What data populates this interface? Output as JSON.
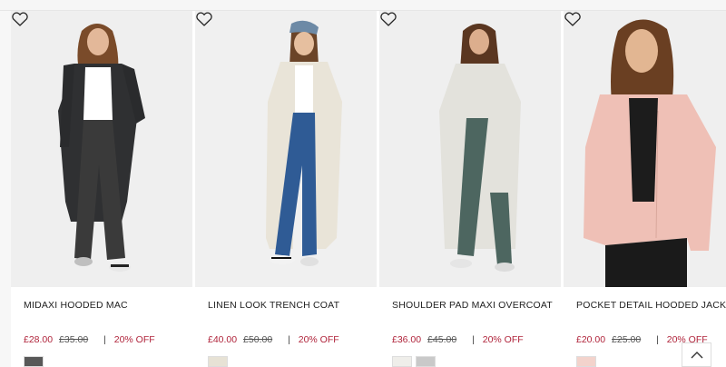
{
  "products": [
    {
      "name": "MIDAXI HOODED MAC",
      "price": "£28.00",
      "was": "£35.00",
      "sep": "|",
      "discount": "20% OFF",
      "swatches": [
        "#585858"
      ],
      "bg": "#efefef",
      "coat": "#2f3032"
    },
    {
      "name": "LINEN LOOK TRENCH COAT",
      "price": "£40.00",
      "was": "£50.00",
      "sep": "|",
      "discount": "20% OFF",
      "swatches": [
        "#e7e2d5"
      ],
      "bg": "#f0f0f0",
      "coat": "#e9e4d8"
    },
    {
      "name": "SHOULDER PAD MAXI OVERCOAT",
      "price": "£36.00",
      "was": "£45.00",
      "sep": "|",
      "discount": "20% OFF",
      "swatches": [
        "#efeeea",
        "#c9c9c9"
      ],
      "bg": "#efefef",
      "coat": "#e3e2dc"
    },
    {
      "name": "POCKET DETAIL HOODED JACKET",
      "price": "£20.00",
      "was": "£25.00",
      "sep": "|",
      "discount": "20% OFF",
      "swatches": [
        "#f3d3cc"
      ],
      "bg": "#efefef",
      "coat": "#efc0b6"
    }
  ],
  "icons": {
    "wishlist": "heart-outline-icon",
    "back_to_top": "chevron-up-icon"
  },
  "colors": {
    "sale": "#b0243b"
  }
}
